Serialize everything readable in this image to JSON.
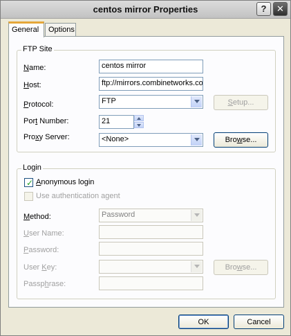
{
  "window": {
    "title": "centos mirror Properties",
    "help_glyph": "?",
    "close_glyph": "✕"
  },
  "tabs": [
    {
      "label": "General",
      "active": true
    },
    {
      "label": "Options",
      "active": false
    }
  ],
  "ftp_site": {
    "legend": "FTP Site",
    "name": {
      "label_hot": "N",
      "label_rest": "ame:",
      "value": "centos mirror"
    },
    "host": {
      "label_hot": "H",
      "label_rest": "ost:",
      "value": "ftp://mirrors.combinetworks.com"
    },
    "protocol": {
      "label_hot": "P",
      "label_rest": "rotocol:",
      "value": "FTP"
    },
    "setup_button": {
      "label_hot": "S",
      "label_rest": "etup..."
    },
    "port": {
      "label_pre": "Por",
      "label_hot": "t",
      "label_rest": " Number:",
      "value": "21"
    },
    "proxy": {
      "label_pre": "Pro",
      "label_hot": "x",
      "label_rest": "y Server:",
      "value": "<None>"
    },
    "browse_button": {
      "label_pre": "Bro",
      "label_hot": "w",
      "label_rest": "se..."
    }
  },
  "login": {
    "legend": "Login",
    "anonymous": {
      "label_hot": "A",
      "label_rest": "nonymous login",
      "checked": true
    },
    "auth_agent": {
      "label": "Use authentication agent",
      "checked": false
    },
    "method": {
      "label_hot": "M",
      "label_rest": "ethod:",
      "value": "Password"
    },
    "user_name": {
      "label_hot": "U",
      "label_rest": "ser Name:"
    },
    "password": {
      "label_hot": "P",
      "label_rest": "assword:"
    },
    "user_key": {
      "label_pre": "User ",
      "label_hot": "K",
      "label_rest": "ey:"
    },
    "browse_button": {
      "label_pre": "Bro",
      "label_hot": "w",
      "label_rest": "se..."
    },
    "passphrase": {
      "label_pre": "Passp",
      "label_hot": "h",
      "label_rest": "rase:"
    }
  },
  "footer": {
    "ok_label": "OK",
    "cancel_label": "Cancel"
  }
}
